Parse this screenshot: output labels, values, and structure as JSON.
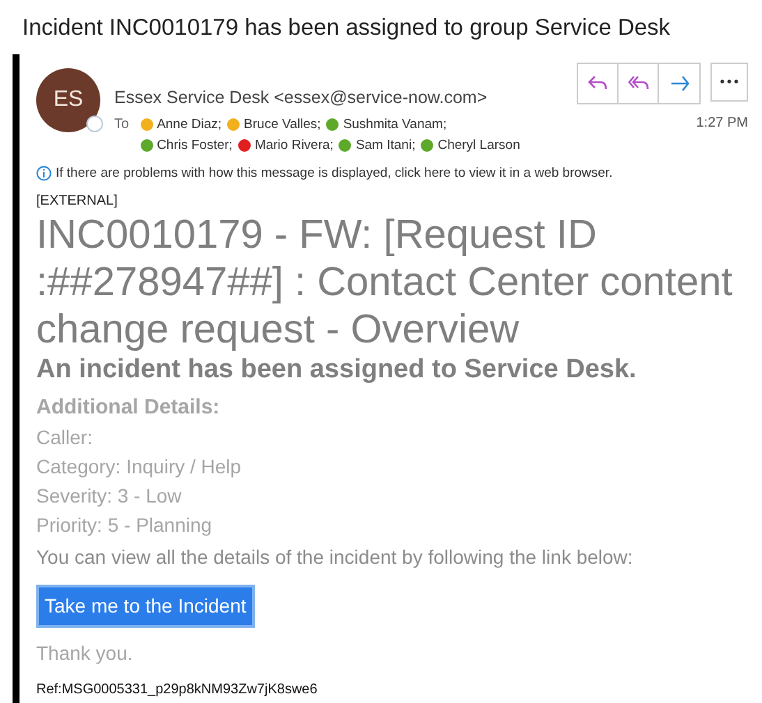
{
  "title": "Incident INC0010179 has been assigned to group Service Desk",
  "sender": {
    "initials": "ES",
    "name": "Essex Service Desk <essex@service-now.com>"
  },
  "to_label": "To",
  "recipients": [
    {
      "name": "Anne Diaz;",
      "color": "#f2b01e"
    },
    {
      "name": "Bruce Valles;",
      "color": "#f2b01e"
    },
    {
      "name": "Sushmita Vanam;",
      "color": "#5ea82a"
    },
    {
      "name": "Chris Foster;",
      "color": "#5ea82a"
    },
    {
      "name": "Mario Rivera;",
      "color": "#e02020"
    },
    {
      "name": "Sam Itani;",
      "color": "#5ea82a"
    },
    {
      "name": "Cheryl Larson",
      "color": "#5ea82a"
    }
  ],
  "time": "1:27 PM",
  "info_bar": "If there are problems with how this message is displayed, click here to view it in a web browser.",
  "body": {
    "tag": "[EXTERNAL]",
    "heading": "INC0010179 - FW: [Request ID :##278947##] : Contact Center content change request - Overview",
    "summary": "An incident has been assigned to Service Desk.",
    "details_title": "Additional Details:",
    "details": [
      "Caller:",
      "Category: Inquiry / Help",
      "Severity: 3 - Low",
      "Priority: 5 - Planning"
    ],
    "instruction": "You can view all the details of the incident by following the link below:",
    "link": {
      "label": "Take me to the Incident",
      "selected": true
    },
    "closing": "Thank you.",
    "ref": "Ref:MSG0005331_p29p8kNM93Zw7jK8swe6"
  }
}
